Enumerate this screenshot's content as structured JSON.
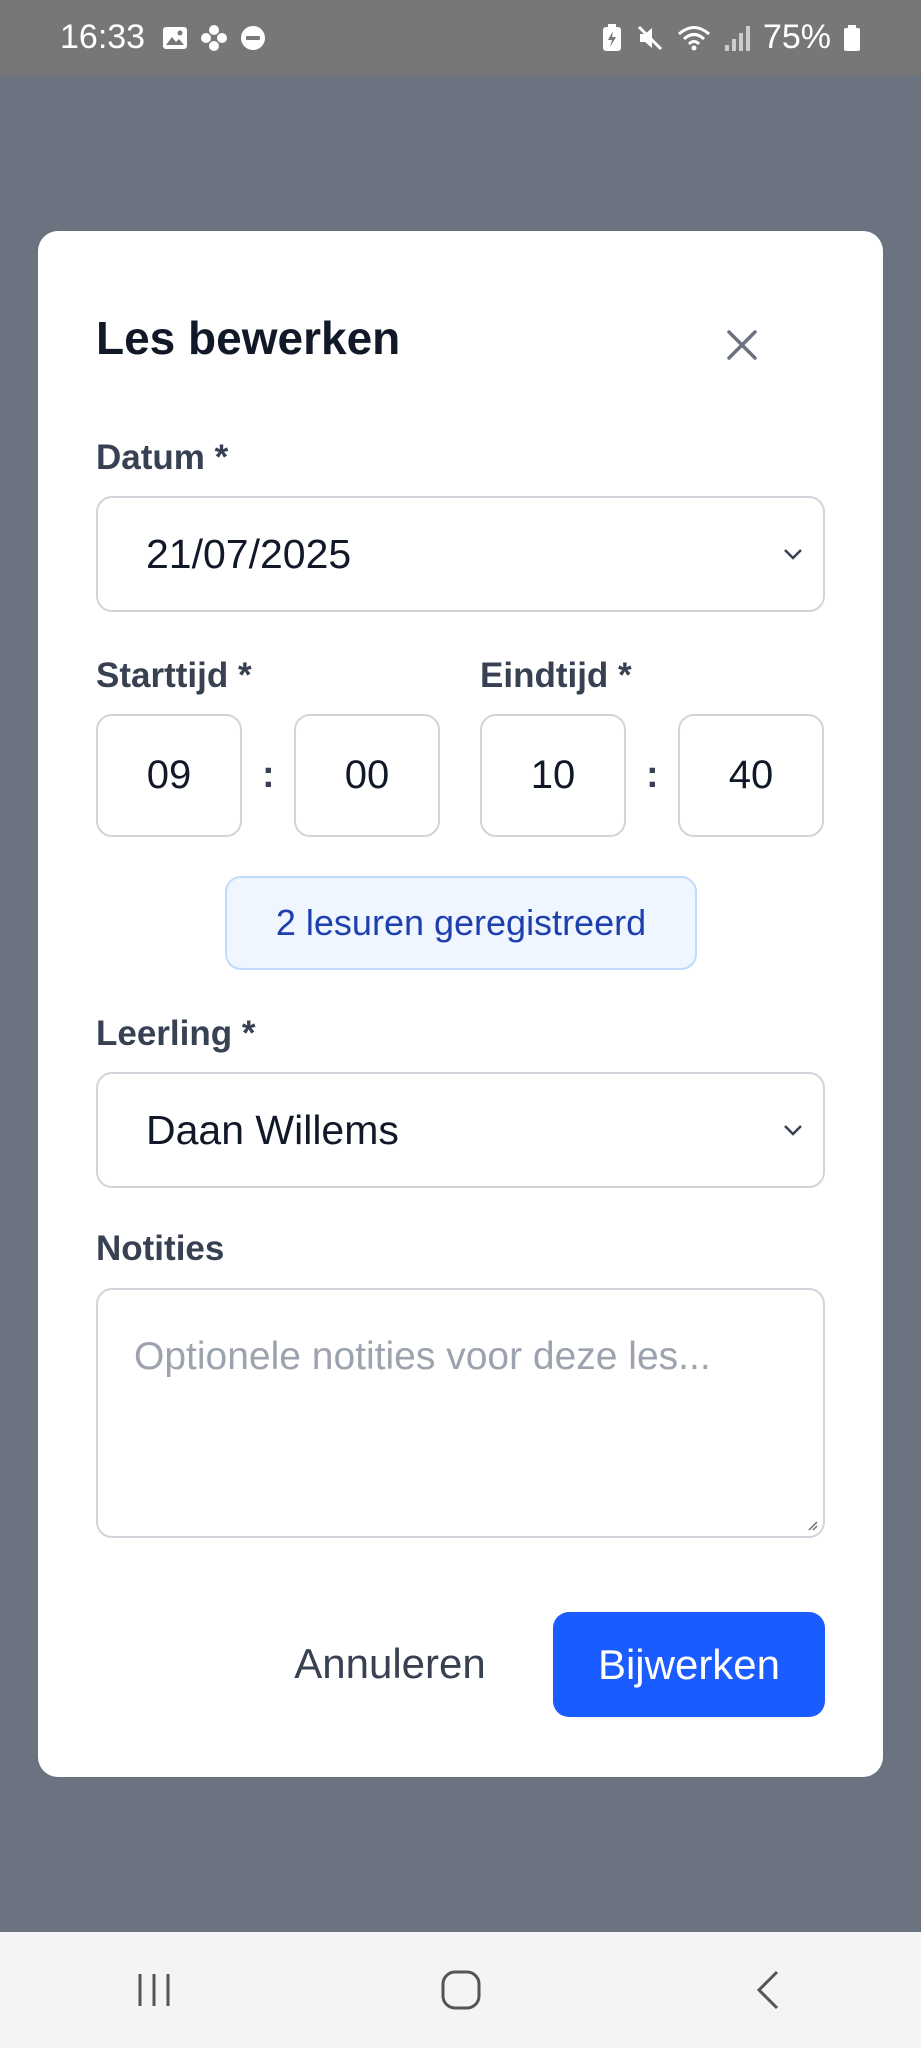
{
  "status_bar": {
    "time": "16:33",
    "left_icons": [
      "image-icon",
      "flower-icon",
      "dnd-icon"
    ],
    "right_icons": [
      "battery-saver-icon",
      "mute-icon",
      "wifi-icon",
      "signal-icon"
    ],
    "battery": "75%"
  },
  "modal": {
    "title": "Les bewerken",
    "date": {
      "label": "Datum *",
      "value": "21/07/2025"
    },
    "start_time": {
      "label": "Starttijd *",
      "hour": "09",
      "minute": "00"
    },
    "end_time": {
      "label": "Eindtijd *",
      "hour": "10",
      "minute": "40"
    },
    "time_separator": ":",
    "registered_badge": "2 lesuren geregistreerd",
    "student": {
      "label": "Leerling *",
      "value": "Daan Willems"
    },
    "notes": {
      "label": "Notities",
      "placeholder": "Optionele notities voor deze les..."
    },
    "cancel_label": "Annuleren",
    "submit_label": "Bijwerken"
  },
  "colors": {
    "overlay": "#6b7280",
    "primary": "#1a5cff",
    "badge_bg": "#eff6ff",
    "badge_text": "#1e40af"
  },
  "nav_bar": {
    "items": [
      "recents-icon",
      "home-icon",
      "back-icon"
    ]
  }
}
